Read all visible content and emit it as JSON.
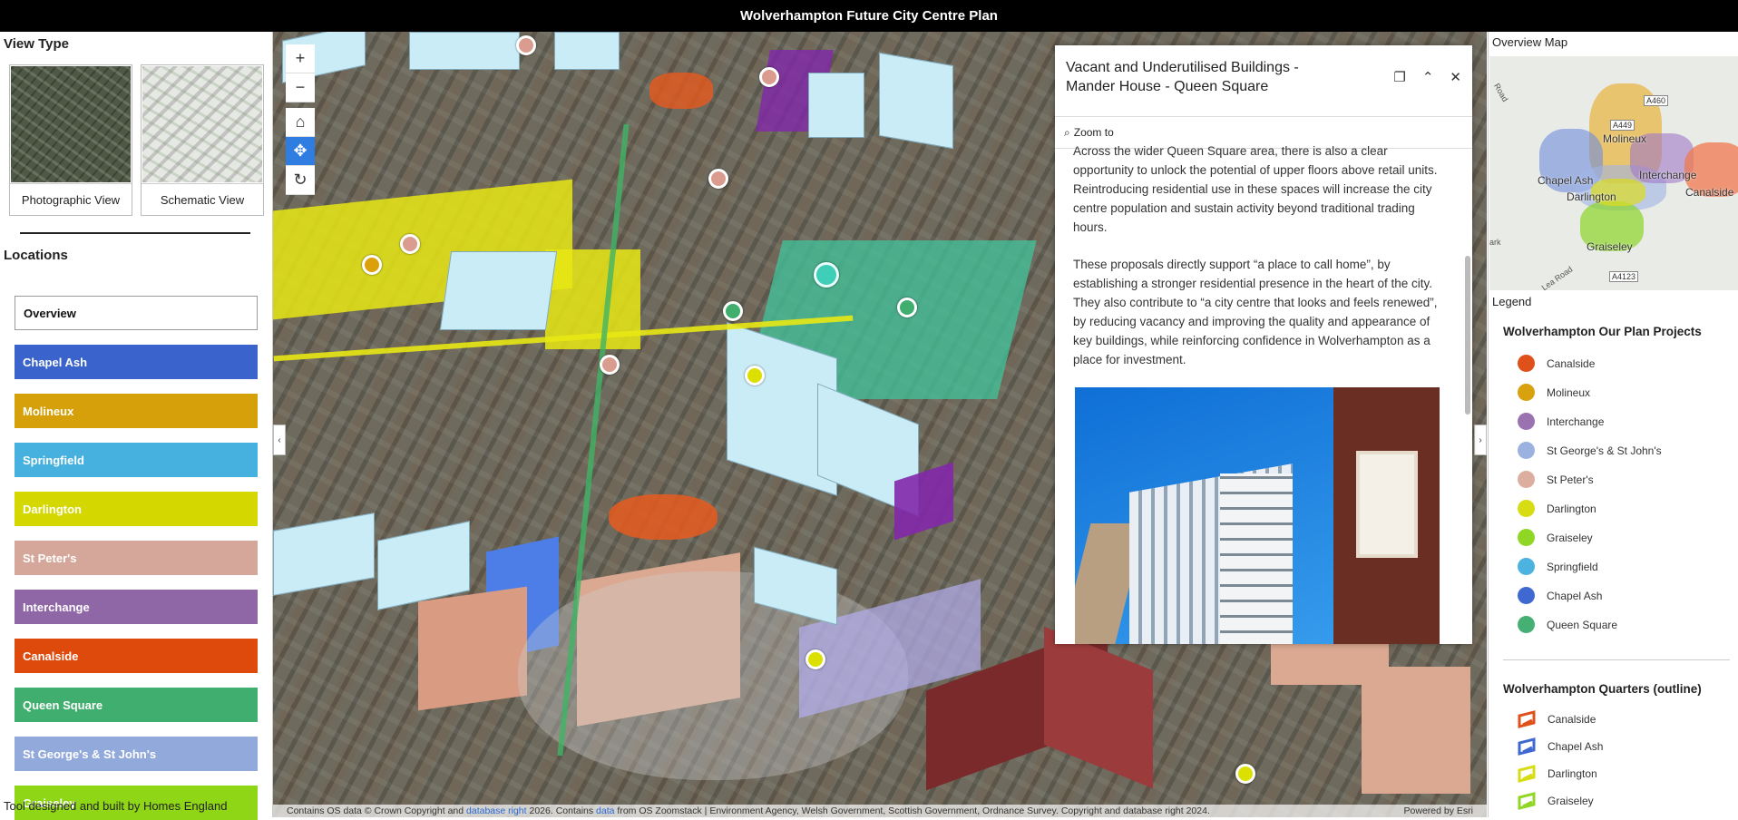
{
  "app": {
    "title": "Wolverhampton Future City Centre Plan"
  },
  "view_type": {
    "heading": "View Type",
    "options": [
      {
        "label": "Photographic View"
      },
      {
        "label": "Schematic View"
      }
    ]
  },
  "locations": {
    "heading": "Locations",
    "items": [
      {
        "label": "Overview",
        "color": "#ffffff"
      },
      {
        "label": "Chapel Ash",
        "color": "#3a64cc"
      },
      {
        "label": "Molineux",
        "color": "#d6a00a"
      },
      {
        "label": "Springfield",
        "color": "#46b0de"
      },
      {
        "label": "Darlington",
        "color": "#d4d800"
      },
      {
        "label": "St Peter's",
        "color": "#d5a79a"
      },
      {
        "label": "Interchange",
        "color": "#8f66a6"
      },
      {
        "label": "Canalside",
        "color": "#dd4a0c"
      },
      {
        "label": "Queen Square",
        "color": "#3fae6f"
      },
      {
        "label": "St George's & St John's",
        "color": "#92a9dc"
      },
      {
        "label": "Graiseley",
        "color": "#8ed616"
      }
    ]
  },
  "footer_note": "Tool designed and built by Homes England",
  "map": {
    "tools": [
      {
        "icon": "plus-icon",
        "glyph": "+"
      },
      {
        "icon": "minus-icon",
        "glyph": "−"
      },
      {
        "icon": "home-icon",
        "glyph": "⌂"
      },
      {
        "icon": "pan-icon",
        "glyph": "✥"
      },
      {
        "icon": "rotate-icon",
        "glyph": "↻"
      }
    ],
    "attribution_text": "Contains OS data © Crown Copyright and",
    "attribution_link1": "database right",
    "attribution_mid": " 2026. Contains ",
    "attribution_link2": "data",
    "attribution_rest": " from OS Zoomstack | Environment Agency, Welsh Government, Scottish Government, Ordnance Survey. Copyright and database right 2024.",
    "powered_by": "Powered by Esri"
  },
  "popup": {
    "title": "Vacant and Underutilised Buildings - Mander House - Queen Square",
    "zoom_label": "Zoom to",
    "paragraphs": [
      "Across the wider Queen Square area, there is also a clear opportunity to unlock the potential of upper floors above retail units. Reintroducing residential use in these spaces will increase the city centre population and sustain activity beyond traditional trading hours.",
      "These proposals directly support “a place to call home”, by establishing a stronger residential presence in the heart of the city. They also contribute to “a city centre that looks and feels renewed”, by reducing vacancy and improving the quality and appearance of key buildings, while reinforcing confidence in Wolverhampton as a place for investment."
    ]
  },
  "overview_map": {
    "heading": "Overview Map",
    "labels": [
      "Molineux",
      "Chapel Ash",
      "Interchange",
      "Darlington",
      "Canalside",
      "Graiseley",
      "Road",
      "Lea Road",
      "ark",
      "A460",
      "A449",
      "A4123"
    ]
  },
  "legend": {
    "heading": "Legend",
    "projects_title": "Wolverhampton Our Plan Projects",
    "projects": [
      {
        "label": "Canalside",
        "color": "#e0501a"
      },
      {
        "label": "Molineux",
        "color": "#d8a20e"
      },
      {
        "label": "Interchange",
        "color": "#9b72b0"
      },
      {
        "label": "St George's & St John's",
        "color": "#9bb2e0"
      },
      {
        "label": "St Peter's",
        "color": "#dcaea0"
      },
      {
        "label": "Darlington",
        "color": "#d8dc12"
      },
      {
        "label": "Graiseley",
        "color": "#90d625"
      },
      {
        "label": "Springfield",
        "color": "#4cb3e0"
      },
      {
        "label": "Chapel Ash",
        "color": "#3f69d0"
      },
      {
        "label": "Queen Square",
        "color": "#46b074"
      }
    ],
    "quarters_title": "Wolverhampton Quarters (outline)",
    "quarters": [
      {
        "label": "Canalside",
        "color": "#e0501a"
      },
      {
        "label": "Chapel Ash",
        "color": "#3f69d0"
      },
      {
        "label": "Darlington",
        "color": "#d8dc12"
      },
      {
        "label": "Graiseley",
        "color": "#90d625"
      }
    ]
  }
}
